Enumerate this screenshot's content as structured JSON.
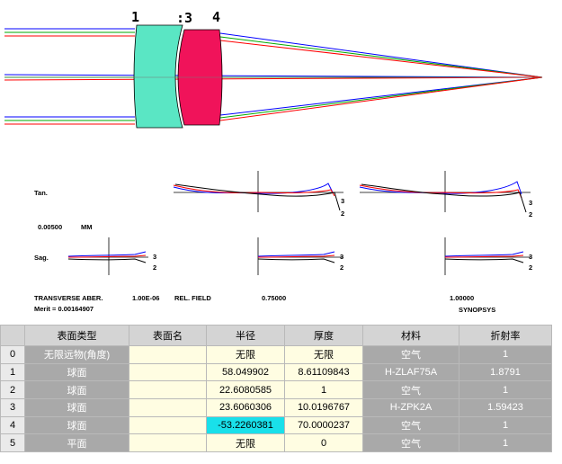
{
  "lens_layout": {
    "surface_labels": [
      "1",
      ":3",
      "4"
    ],
    "element1_color": "#5ae6c4",
    "element2_color": "#f0135a"
  },
  "aberration": {
    "tan_label": "Tan.",
    "sag_label": "Sag.",
    "scale_value": "0.00500",
    "scale_unit": "MM",
    "plot_title": "TRANSVERSE ABER.",
    "wavelength_value": "1.00E-06",
    "field_label": "REL. FIELD",
    "field_values": [
      "0.75000",
      "1.00000"
    ],
    "merit": "Merit = 0.00164907",
    "brand": "SYNOPSYS",
    "curve_labels": [
      "3",
      "2"
    ]
  },
  "table": {
    "headers": [
      "",
      "表面类型",
      "表面名",
      "半径",
      "厚度",
      "材料",
      "折射率"
    ],
    "rows": [
      {
        "num": "0",
        "type": "无限远物(角度)",
        "name": "",
        "radius": "无限",
        "thickness": "无限",
        "material": "空气",
        "index": "1"
      },
      {
        "num": "1",
        "type": "球面",
        "name": "",
        "radius": "58.049902",
        "thickness": "8.61109843",
        "material": "H-ZLAF75A",
        "index": "1.8791"
      },
      {
        "num": "2",
        "type": "球面",
        "name": "",
        "radius": "22.6080585",
        "thickness": "1",
        "material": "空气",
        "index": "1"
      },
      {
        "num": "3",
        "type": "球面",
        "name": "",
        "radius": "23.6060306",
        "thickness": "10.0196767",
        "material": "H-ZPK2A",
        "index": "1.59423"
      },
      {
        "num": "4",
        "type": "球面",
        "name": "",
        "radius": "-53.2260381",
        "thickness": "70.0000237",
        "material": "空气",
        "index": "1"
      },
      {
        "num": "5",
        "type": "平面",
        "name": "",
        "radius": "无限",
        "thickness": "0",
        "material": "空气",
        "index": "1"
      }
    ]
  }
}
